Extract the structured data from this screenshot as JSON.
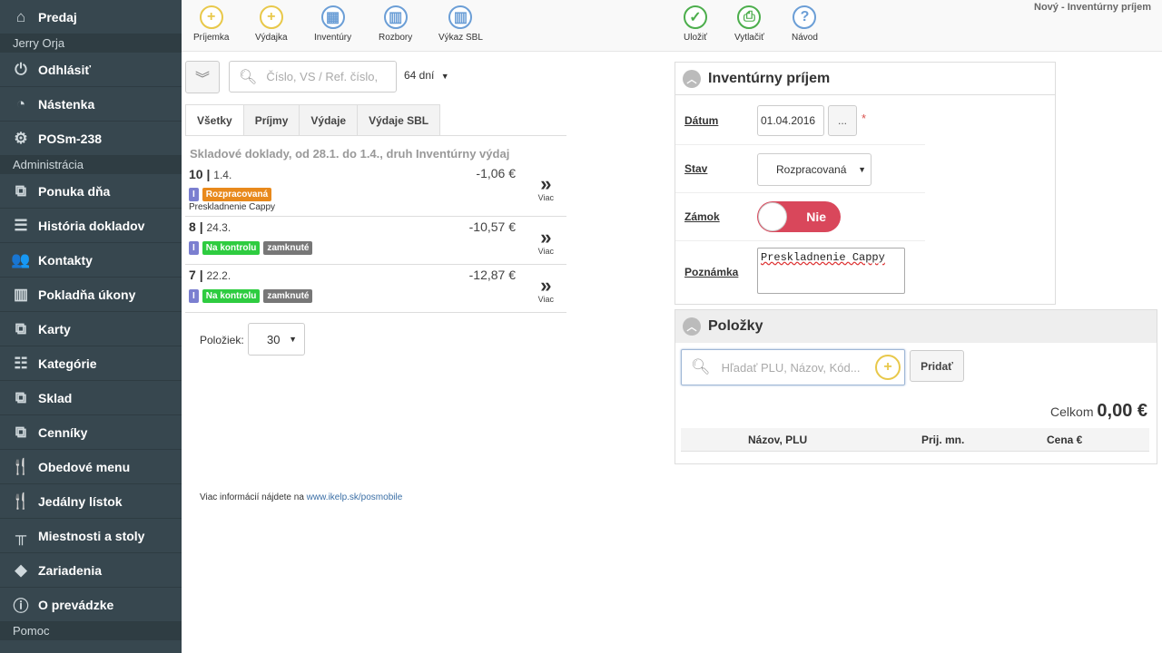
{
  "sidebar": {
    "items": [
      {
        "label": "Predaj",
        "icon": "home-icon"
      },
      {
        "section": "Jerry Orja"
      },
      {
        "label": "Odhlásiť",
        "icon": "power-icon"
      },
      {
        "label": "Nástenka",
        "icon": "dashboard-icon"
      },
      {
        "label": "POSm-238",
        "icon": "gear-icon"
      },
      {
        "section": "Administrácia"
      },
      {
        "label": "Ponuka dňa",
        "icon": "boxes-star-icon"
      },
      {
        "label": "História dokladov",
        "icon": "list-icon"
      },
      {
        "label": "Kontakty",
        "icon": "users-icon"
      },
      {
        "label": "Pokladňa úkony",
        "icon": "bar-chart-icon"
      },
      {
        "label": "Karty",
        "icon": "boxes-icon"
      },
      {
        "label": "Kategórie",
        "icon": "tree-icon"
      },
      {
        "label": "Sklad",
        "icon": "boxes-icon"
      },
      {
        "label": "Cenníky",
        "icon": "boxes-icon"
      },
      {
        "label": "Obedové menu",
        "icon": "cutlery-icon"
      },
      {
        "label": "Jedálny lístok",
        "icon": "cutlery-icon"
      },
      {
        "label": "Miestnosti a stoly",
        "icon": "table-icon"
      },
      {
        "label": "Zariadenia",
        "icon": "diamond-icon"
      },
      {
        "label": "O prevádzke",
        "icon": "info-icon"
      },
      {
        "section": "Pomoc"
      }
    ]
  },
  "toolbar": {
    "left": [
      {
        "label": "Príjemka",
        "glyph": "+",
        "color": "yellow"
      },
      {
        "label": "Výdajka",
        "glyph": "+",
        "color": "yellow"
      },
      {
        "label": "Inventúry",
        "glyph": "▦",
        "color": "blue"
      },
      {
        "label": "Rozbory",
        "glyph": "▥",
        "color": "blue"
      },
      {
        "label": "Výkaz SBL",
        "glyph": "▥",
        "color": "blue"
      }
    ],
    "right": [
      {
        "label": "Uložiť",
        "glyph": "✓",
        "color": "green"
      },
      {
        "label": "Vytlačiť",
        "glyph": "⎙",
        "color": "green"
      },
      {
        "label": "Návod",
        "glyph": "?",
        "color": "blue"
      }
    ],
    "page_title": "Nový - Inventúrny príjem"
  },
  "list": {
    "search_placeholder": "Číslo, VS / Ref. číslo,",
    "days": "64 dní",
    "tabs": [
      "Všetky",
      "Príjmy",
      "Výdaje",
      "Výdaje SBL"
    ],
    "caption": "Skladové doklady, od 28.1. do 1.4., druh Inventúrny výdaj",
    "rows": [
      {
        "num": "10",
        "sep": "|",
        "date": "1.4.",
        "amount": "-1,06 €",
        "type_badge": "I",
        "status": "Rozpracovaná",
        "note": "Preskladnenie Cappy",
        "more": "Viac"
      },
      {
        "num": "8",
        "sep": "|",
        "date": "24.3.",
        "amount": "-10,57 €",
        "type_badge": "I",
        "status": "Na kontrolu",
        "lock": "zamknuté",
        "more": "Viac"
      },
      {
        "num": "7",
        "sep": "|",
        "date": "22.2.",
        "amount": "-12,87 €",
        "type_badge": "I",
        "status": "Na kontrolu",
        "lock": "zamknuté",
        "more": "Viac"
      }
    ],
    "per_page_label": "Položiek:",
    "per_page": "30",
    "footer_text": "Viac informácií nájdete na",
    "footer_link": "www.ikelp.sk/posmobile"
  },
  "detail": {
    "title": "Inventúrny príjem",
    "date_label": "Dátum",
    "date_value": "01.04.2016",
    "date_btn": "...",
    "required": "*",
    "status_label": "Stav",
    "status_value": "Rozpracovaná",
    "lock_label": "Zámok",
    "lock_value": "Nie",
    "note_label": "Poznámka",
    "note_value": "Preskladnenie Cappy"
  },
  "items": {
    "title": "Položky",
    "search_placeholder": "Hľadať PLU, Názov, Kód...",
    "add_label": "Pridať",
    "total_label": "Celkom",
    "total_value": "0,00 €",
    "columns": [
      "Názov, PLU",
      "Prij. mn.",
      "Cena €"
    ]
  },
  "colors": {
    "sidebar_bg": "#37474f",
    "accent_yellow": "#e8c84a",
    "accent_blue": "#6b9ed6",
    "accent_green": "#4cae4c",
    "status_orange": "#e8891c",
    "status_green": "#2ecc40",
    "toggle_red": "#d9475b"
  }
}
